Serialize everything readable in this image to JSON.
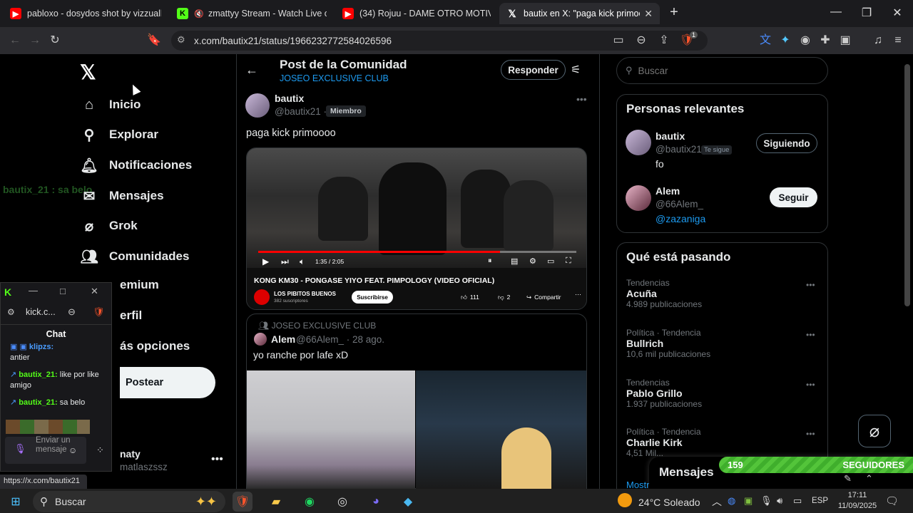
{
  "tabs": [
    {
      "title": "pabloxo - dosydos shot by vizzualb -",
      "icon": "youtube-icon"
    },
    {
      "title": "zmattyy Stream - Watch Live on K",
      "icon": "kick-icon"
    },
    {
      "title": "(34) Rojuu - DAME OTRO MOTIVO #T",
      "icon": "youtube-icon"
    },
    {
      "title": "bautix en X: \"paga kick primoooo\"",
      "icon": "x-icon"
    }
  ],
  "address": {
    "url": "x.com/bautix21/status/1966232772584026596",
    "brave_badge": "1"
  },
  "nav": {
    "items": [
      "Inicio",
      "Explorar",
      "Notificaciones",
      "Mensajes",
      "Grok",
      "Comunidades",
      "emium",
      "erfil",
      "ás opciones"
    ],
    "post_label": "Postear",
    "account_name": "naty",
    "account_handle": "matlaszssz",
    "ghost_text": "bautix_21 : sa belo"
  },
  "header": {
    "title": "Post de la Comunidad",
    "subtitle": "JOSEO EXCLUSIVE CLUB",
    "reply_label": "Responder"
  },
  "post": {
    "name": "bautix",
    "handle": "@bautix21 ·",
    "badge": "Miembro",
    "text": "paga kick primoooo",
    "video": {
      "time": "1:35 / 2:05",
      "title": "KONG KM30 - PONGASE YIYO FEAT. PIMPOLOGY (VIDEO OFICIAL)",
      "channel": "LOS PIBITOS BUENOS",
      "subs": "382 suscriptores",
      "subscribe": "Suscribirse",
      "likes": "111",
      "dislikes": "2",
      "share": "Compartir",
      "progress": 0.76
    }
  },
  "reply": {
    "community": "JOSEO EXCLUSIVE CLUB",
    "name": "Alem",
    "meta": "@66Alem_ · 28 ago.",
    "text": "yo ranche por lafe xD"
  },
  "search": {
    "placeholder": "Buscar"
  },
  "relevant": {
    "title": "Personas relevantes",
    "people": [
      {
        "name": "bautix",
        "handle": "@bautix21",
        "tag": "Te sigue",
        "bio": "fo",
        "button": "Siguiendo"
      },
      {
        "name": "Alem",
        "handle": "@66Alem_",
        "tag": "",
        "bio": "@zazaniga",
        "button": "Seguir"
      }
    ]
  },
  "trends": {
    "title": "Qué está pasando",
    "items": [
      {
        "cat": "Tendencias",
        "name": "Acuña",
        "count": "4.989 publicaciones"
      },
      {
        "cat": "Política · Tendencia",
        "name": "Bullrich",
        "count": "10,6 mil publicaciones"
      },
      {
        "cat": "Tendencias",
        "name": "Pablo Grillo",
        "count": "1.937 publicaciones"
      },
      {
        "cat": "Política · Tendencia",
        "name": "Charlie Kirk",
        "count": "4,51 Mil..."
      }
    ],
    "more": "Mostr..."
  },
  "messages_drawer": {
    "label": "Mensajes"
  },
  "followers_overlay": {
    "count": "159",
    "label": "SEGUIDORES"
  },
  "kick": {
    "url": "kick.c...",
    "chat_label": "Chat",
    "lines": [
      {
        "user": "klipzs:",
        "text": "antier"
      },
      {
        "user": "bautix_21:",
        "text": "like por like amigo"
      },
      {
        "user": "bautix_21:",
        "text": "sa belo"
      }
    ],
    "placeholder": "Enviar un mensaje"
  },
  "status_url": "https://x.com/bautix21",
  "taskbar": {
    "search": "Buscar",
    "weather": "24°C Soleado",
    "lang": "ESP",
    "time": "17:11",
    "date": "11/09/2025"
  }
}
